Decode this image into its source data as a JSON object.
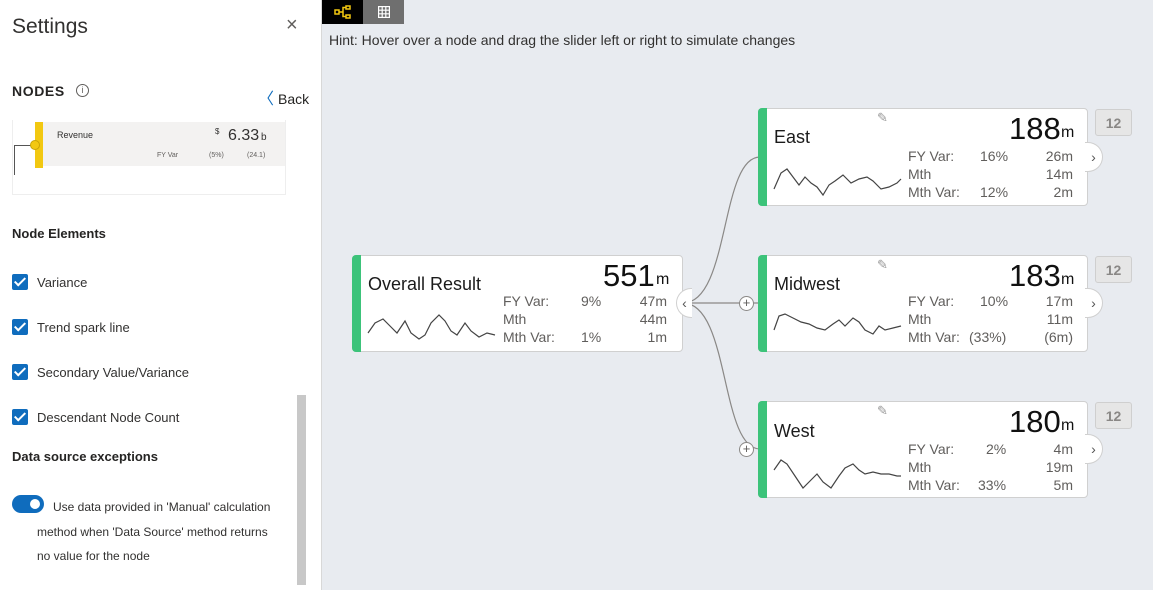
{
  "panel": {
    "title": "Settings",
    "close_glyph": "×",
    "nodes_heading": "NODES",
    "info_glyph": "i",
    "back_label": "Back",
    "back_glyph": "〈"
  },
  "preview_node": {
    "name": "Revenue",
    "currency": "$",
    "value": "6.33",
    "unit": "b",
    "fy_var_label": "FY Var",
    "fy_var_pct": "(5%)",
    "fy_var_abs": "(24.1)",
    "color": "#f2c811"
  },
  "node_elements": {
    "heading": "Node Elements",
    "items": [
      {
        "label": "Variance",
        "checked": true
      },
      {
        "label": "Trend spark line",
        "checked": true
      },
      {
        "label": "Secondary Value/Variance",
        "checked": true
      },
      {
        "label": "Descendant Node Count",
        "checked": true
      }
    ]
  },
  "data_source": {
    "heading": "Data source exceptions",
    "toggle_on": true,
    "lines": [
      "Use data provided in 'Manual' calculation",
      "method when 'Data Source' method returns",
      "no value for the node"
    ]
  },
  "toolbar": {
    "tree_icon": "decomposition-tree-icon",
    "grid_icon": "grid-table-icon",
    "active_color": "#f2c811"
  },
  "hint": "Hint: Hover over a node and drag the slider left or right to simulate changes",
  "accent_color": "#3cc37a",
  "nodes": {
    "root": {
      "name": "Overall Result",
      "value": "551",
      "unit": "m",
      "rows": [
        {
          "label": "FY Var:",
          "pct": "9%",
          "abs": "47m"
        },
        {
          "label": "Mth",
          "pct": "",
          "abs": "44m"
        },
        {
          "label": "Mth Var:",
          "pct": "1%",
          "abs": "1m"
        }
      ],
      "collapse_glyph": "‹"
    },
    "children": [
      {
        "name": "East",
        "value": "188",
        "unit": "m",
        "count": "12",
        "rows": [
          {
            "label": "FY Var:",
            "pct": "16%",
            "abs": "26m"
          },
          {
            "label": "Mth",
            "pct": "",
            "abs": "14m"
          },
          {
            "label": "Mth Var:",
            "pct": "12%",
            "abs": "2m"
          }
        ],
        "expand_glyph": "›"
      },
      {
        "name": "Midwest",
        "value": "183",
        "unit": "m",
        "count": "12",
        "rows": [
          {
            "label": "FY Var:",
            "pct": "10%",
            "abs": "17m"
          },
          {
            "label": "Mth",
            "pct": "",
            "abs": "11m"
          },
          {
            "label": "Mth Var:",
            "pct": "(33%)",
            "abs": "(6m)"
          }
        ],
        "expand_glyph": "›"
      },
      {
        "name": "West",
        "value": "180",
        "unit": "m",
        "count": "12",
        "rows": [
          {
            "label": "FY Var:",
            "pct": "2%",
            "abs": "4m"
          },
          {
            "label": "Mth",
            "pct": "",
            "abs": "19m"
          },
          {
            "label": "Mth Var:",
            "pct": "33%",
            "abs": "5m"
          }
        ],
        "expand_glyph": "›"
      }
    ],
    "plus_glyph": "+",
    "pencil_icon": "pencil-icon"
  }
}
